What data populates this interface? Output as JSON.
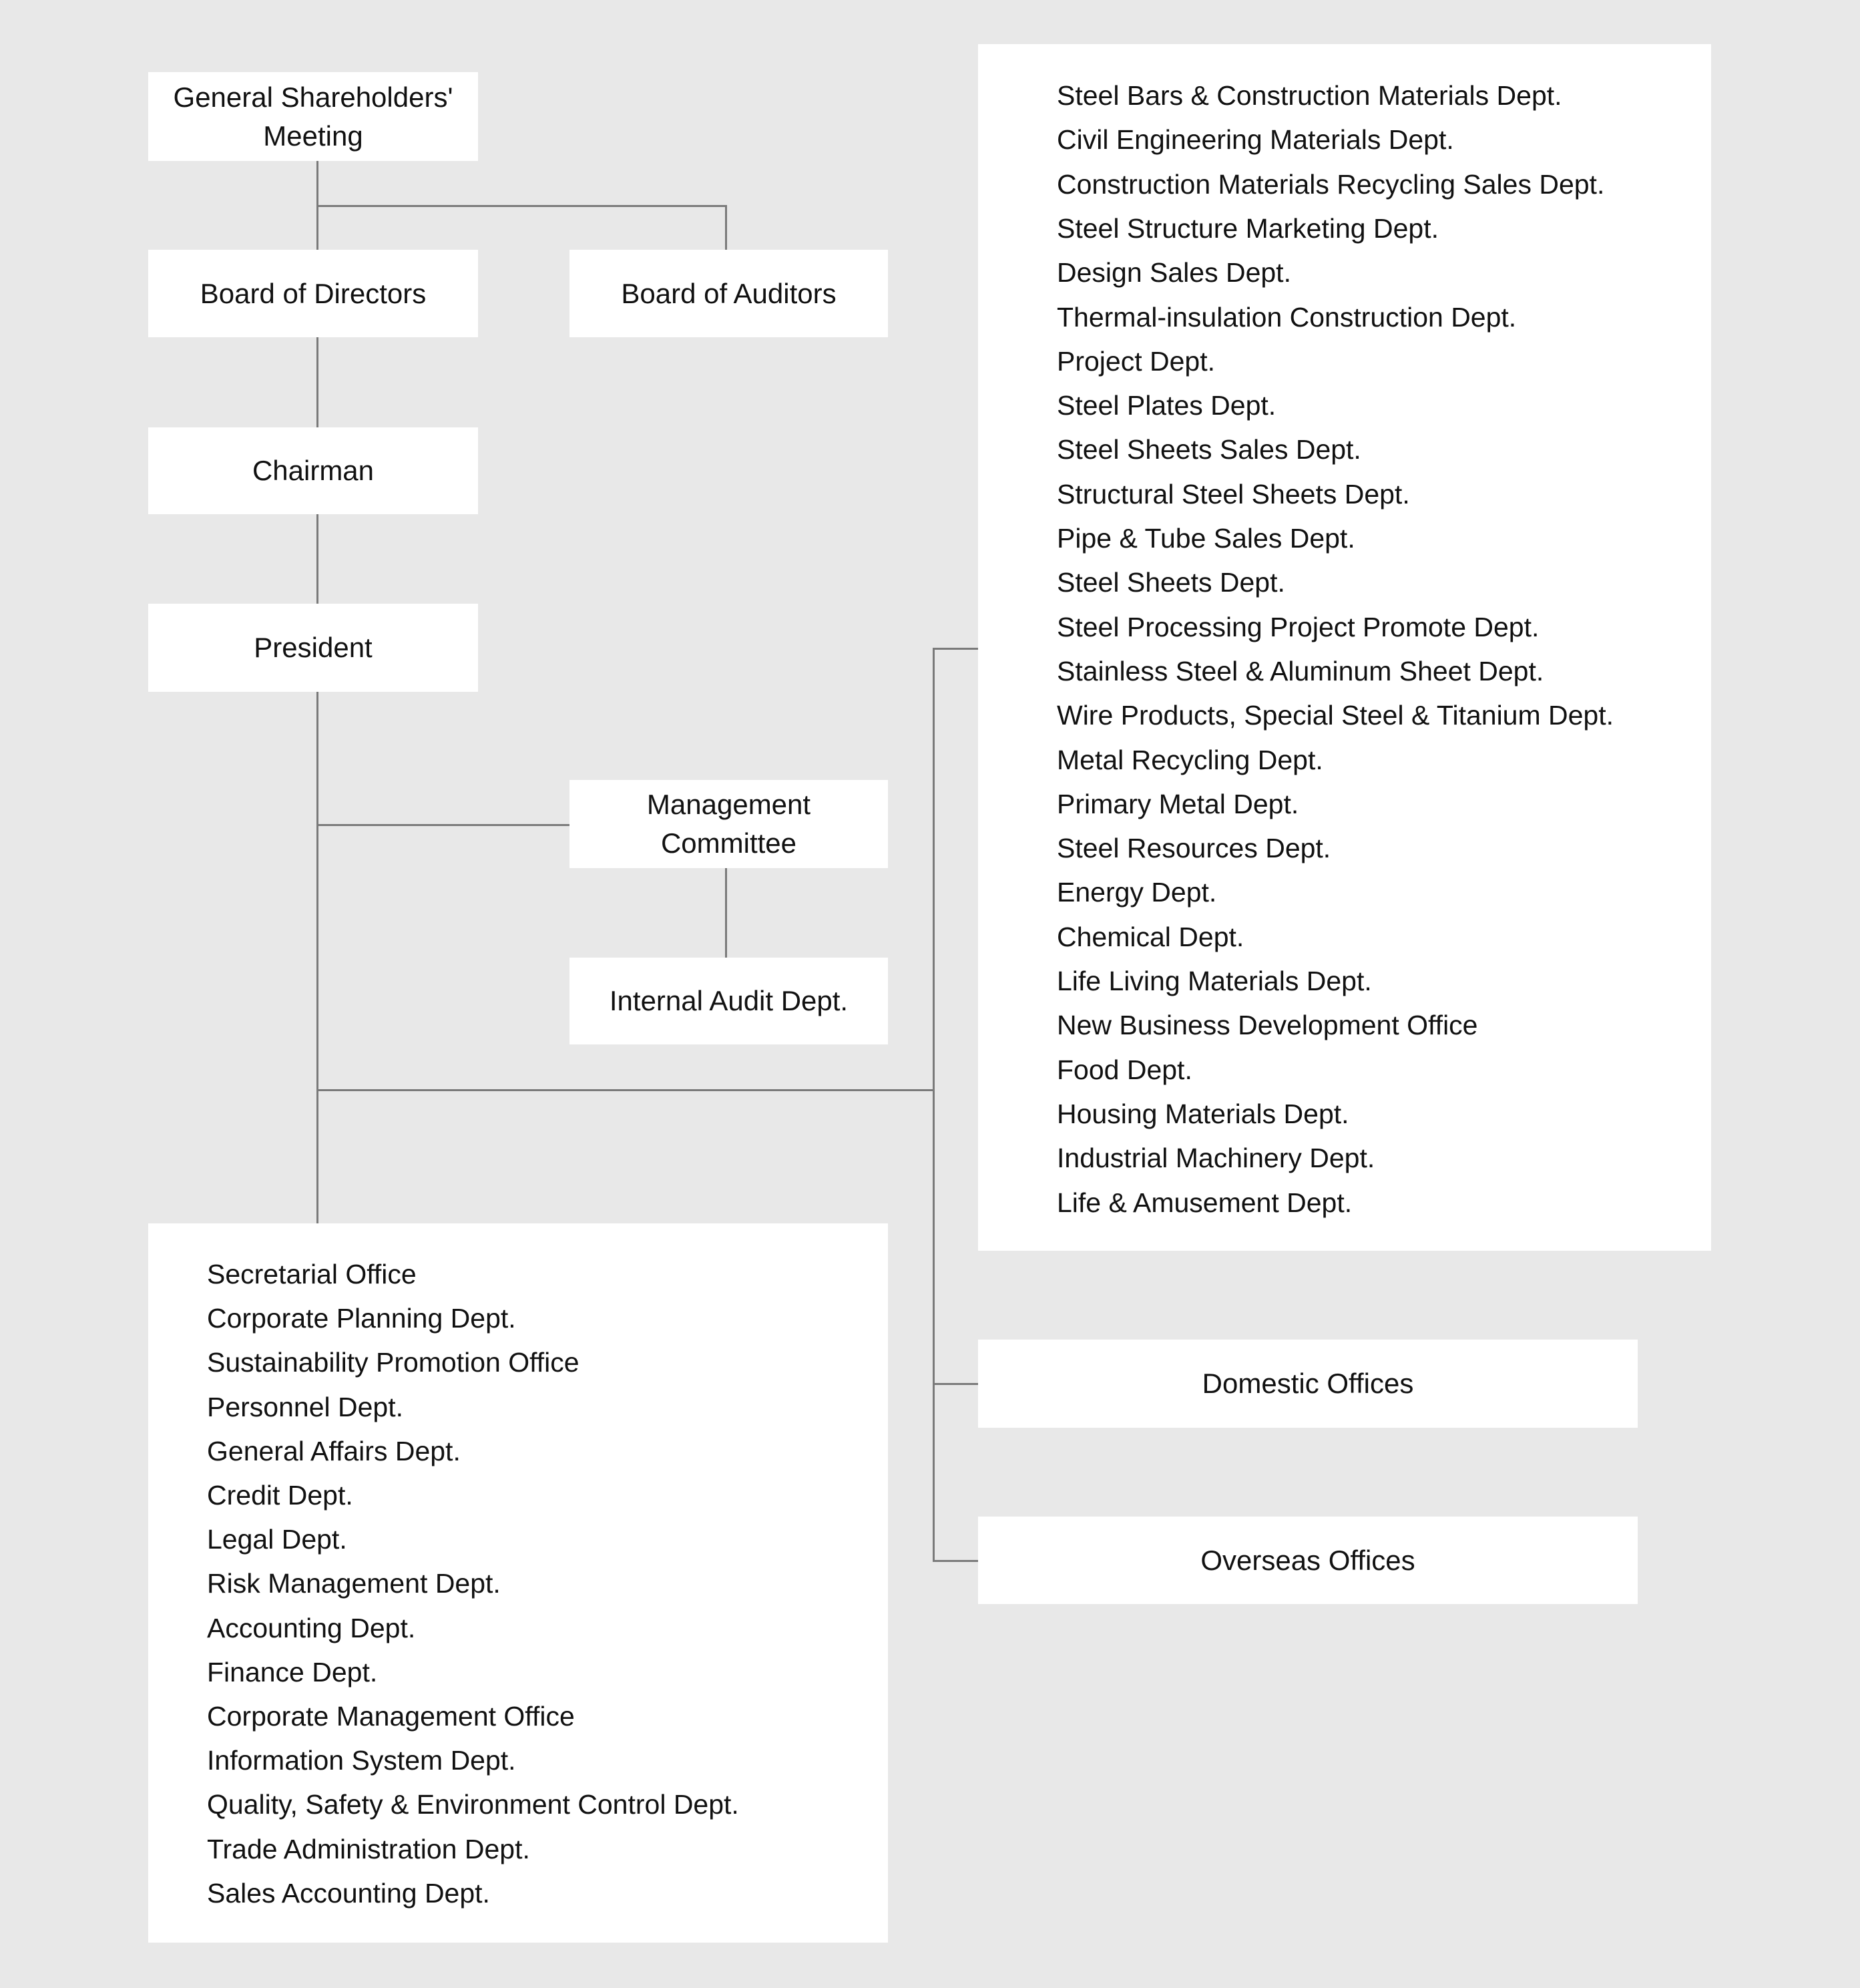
{
  "nodes": {
    "shareholders": "General Shareholders' Meeting",
    "directors": "Board of Directors",
    "auditors": "Board of Auditors",
    "chairman": "Chairman",
    "president": "President",
    "management_committee": "Management Committee",
    "internal_audit": "Internal Audit Dept.",
    "domestic_offices": "Domestic Offices",
    "overseas_offices": "Overseas Offices"
  },
  "business_departments": [
    "Steel Bars & Construction Materials Dept.",
    "Civil Engineering Materials Dept.",
    "Construction Materials Recycling Sales Dept.",
    "Steel Structure Marketing Dept.",
    "Design Sales Dept.",
    "Thermal-insulation Construction Dept.",
    "Project Dept.",
    "Steel Plates Dept.",
    "Steel Sheets Sales Dept.",
    "Structural Steel Sheets Dept.",
    "Pipe & Tube Sales Dept.",
    "Steel Sheets Dept.",
    "Steel Processing Project Promote Dept.",
    "Stainless Steel & Aluminum Sheet Dept.",
    "Wire Products, Special Steel & Titanium Dept.",
    "Metal Recycling Dept.",
    "Primary Metal Dept.",
    "Steel Resources Dept.",
    "Energy Dept.",
    "Chemical Dept.",
    "Life Living Materials Dept.",
    "New Business Development Office",
    "Food Dept.",
    "Housing Materials Dept.",
    "Industrial Machinery Dept.",
    "Life & Amusement Dept."
  ],
  "corporate_departments": [
    "Secretarial Office",
    "Corporate Planning Dept.",
    "Sustainability Promotion Office",
    "Personnel Dept.",
    "General Affairs Dept.",
    "Credit Dept.",
    "Legal Dept.",
    "Risk Management Dept.",
    "Accounting Dept.",
    "Finance Dept.",
    "Corporate Management Office",
    "Information System Dept.",
    "Quality, Safety & Environment Control Dept.",
    "Trade Administration Dept.",
    "Sales Accounting Dept."
  ],
  "colors": {
    "background": "#e8e8e8",
    "box": "#ffffff",
    "connector": "#7a7a7a"
  }
}
